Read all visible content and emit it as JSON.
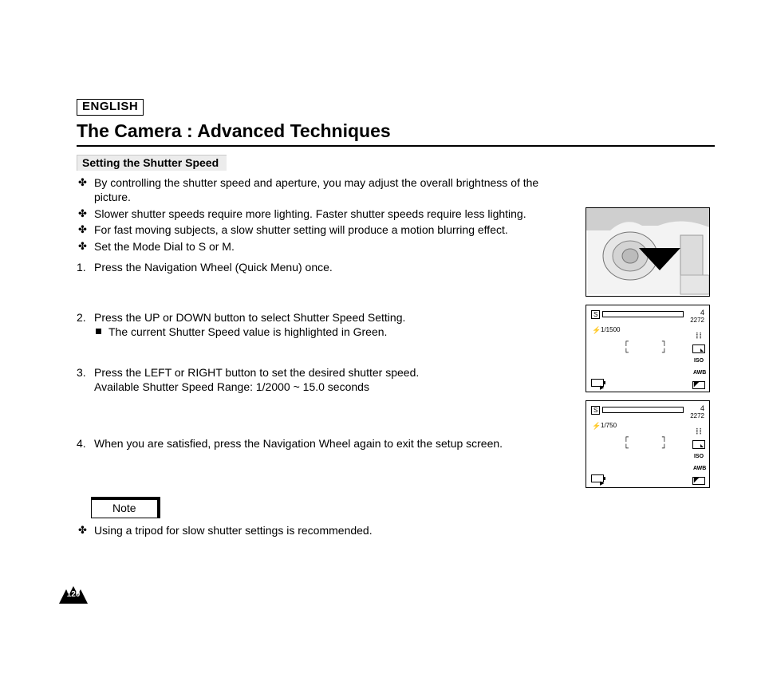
{
  "lang": "ENGLISH",
  "title": "The Camera : Advanced Techniques",
  "section": "Setting the Shutter Speed",
  "bullets": [
    "By controlling the shutter speed and aperture, you may adjust the overall brightness of the picture.",
    "Slower shutter speeds require more lighting. Faster shutter speeds require less lighting.",
    "For fast moving subjects, a slow shutter setting will produce a motion blurring effect.",
    "Set the Mode Dial to S or M."
  ],
  "steps": [
    {
      "n": "1.",
      "text": "Press the Navigation Wheel (Quick Menu) once."
    },
    {
      "n": "2.",
      "text": "Press the UP or DOWN button to select Shutter Speed Setting.",
      "sub": "The current Shutter Speed value is highlighted in Green."
    },
    {
      "n": "3.",
      "text": "Press the LEFT or RIGHT button to set the desired shutter speed.",
      "line2": "Available Shutter Speed Range: 1/2000 ~ 15.0 seconds"
    },
    {
      "n": "4.",
      "text": "When you are satisfied, press the Navigation Wheel again to exit the setup screen."
    }
  ],
  "note_label": "Note",
  "notes": [
    "Using a tripod for slow shutter settings is recommended."
  ],
  "page_number": "120",
  "lcd": {
    "mode": "S",
    "count": "4",
    "resolution": "2272",
    "shutter1": "1/1500",
    "shutter2": "1/750",
    "iso": "ISO",
    "awb": "AWB"
  }
}
